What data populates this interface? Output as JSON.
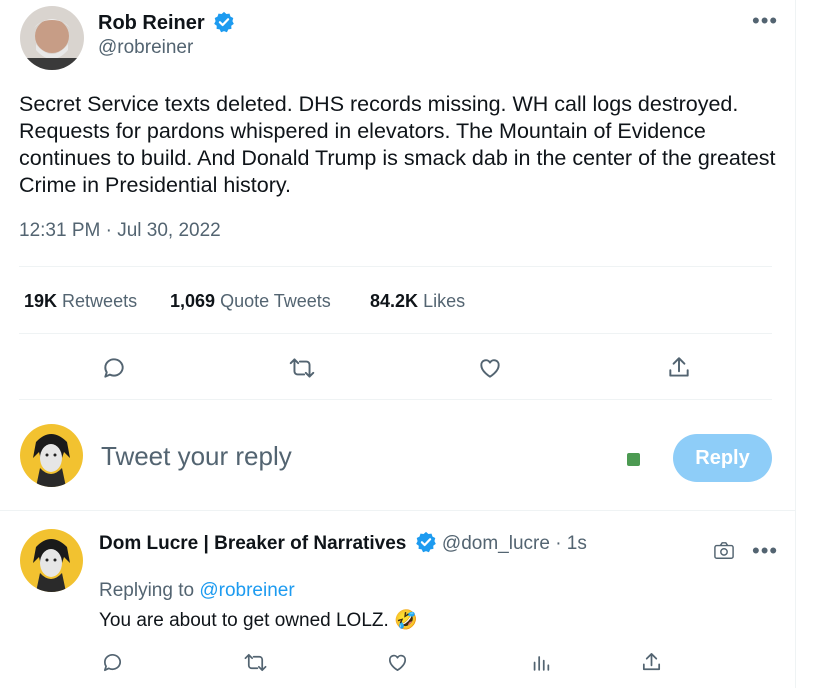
{
  "tweet": {
    "author_name": "Rob Reiner",
    "author_handle": "@robreiner",
    "more_icon": "more-dots-icon",
    "text": "Secret Service texts deleted. DHS records missing. WH call logs destroyed. Requests for pardons whispered in elevators. The Mountain of Evidence continues to build. And Donald Trump is smack dab in the center of the greatest Crime in Presidential history.",
    "timestamp": "12:31 PM · Jul 30, 2022",
    "stats": {
      "retweets_count": "19K",
      "retweets_label": "Retweets",
      "quotes_count": "1,069",
      "quotes_label": "Quote Tweets",
      "likes_count": "84.2K",
      "likes_label": "Likes"
    },
    "actions": [
      "reply-icon",
      "retweet-icon",
      "like-icon",
      "share-icon"
    ]
  },
  "composer": {
    "placeholder": "Tweet your reply",
    "reply_button": "Reply"
  },
  "reply": {
    "author_name": "Dom Lucre | Breaker of Narratives",
    "author_handle": "@dom_lucre",
    "time": "· 1s",
    "replying_to_label": "Replying to",
    "replying_to_handle": "@robreiner",
    "text": "You are about to get owned LOLZ.",
    "emoji": "🤣",
    "actions": [
      "reply-icon",
      "retweet-icon",
      "like-icon",
      "analytics-icon",
      "share-icon"
    ]
  },
  "colors": {
    "accent": "#1d9bf0",
    "reply_button_disabled": "#8ecdf8",
    "secondary_text": "#536471"
  }
}
